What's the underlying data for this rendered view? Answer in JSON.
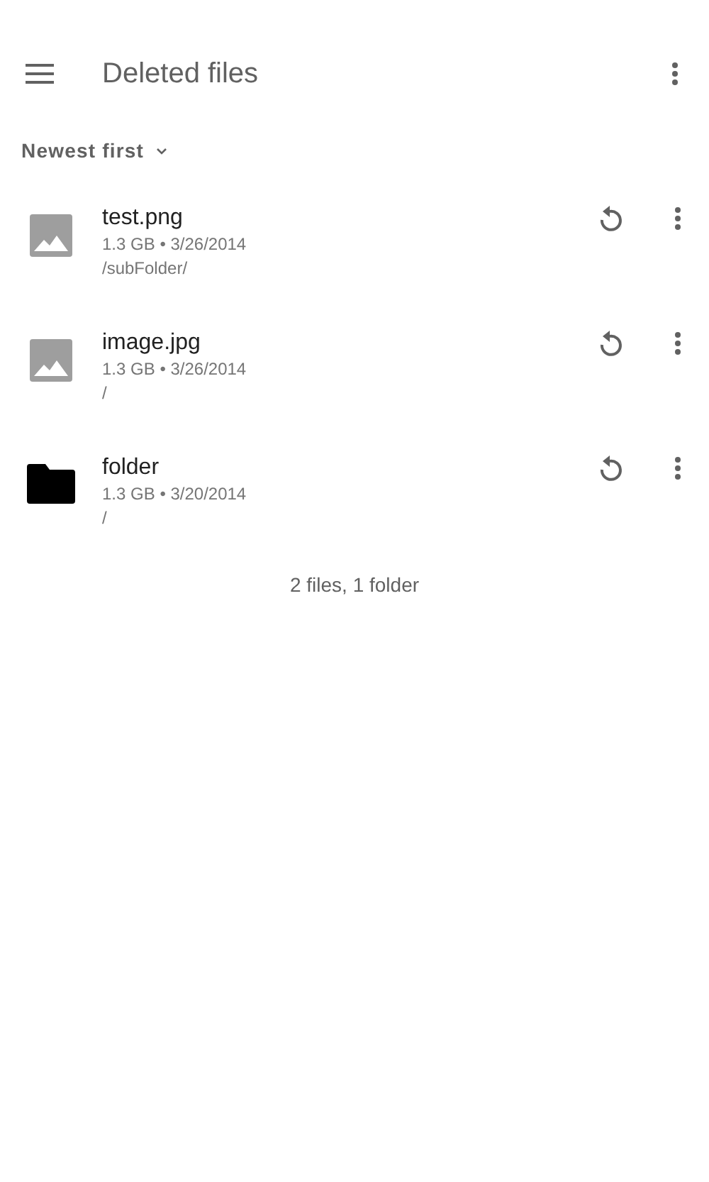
{
  "toolbar": {
    "title": "Deleted files"
  },
  "sort": {
    "label": "Newest first"
  },
  "files": [
    {
      "kind": "image",
      "name": "test.png",
      "meta": "1.3 GB • 3/26/2014",
      "path": "/subFolder/"
    },
    {
      "kind": "image",
      "name": "image.jpg",
      "meta": "1.3 GB • 3/26/2014",
      "path": "/"
    },
    {
      "kind": "folder",
      "name": "folder",
      "meta": "1.3 GB • 3/20/2014",
      "path": "/"
    }
  ],
  "summary": "2 files, 1 folder"
}
